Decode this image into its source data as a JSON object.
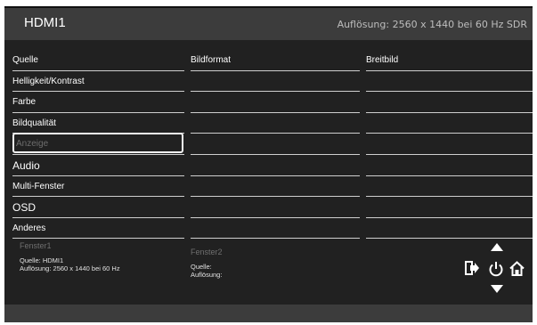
{
  "header": {
    "title": "HDMI1",
    "resolution": "Auflösung: 2560 x 1440 bei 60 Hz SDR"
  },
  "menu": {
    "items": [
      "Quelle",
      "Helligkeit/Kontrast",
      "Farbe",
      "Bildqualität",
      "Anzeige",
      "Audio",
      "Multi-Fenster",
      "OSD",
      "Anderes"
    ],
    "selected": "Anzeige"
  },
  "column2": {
    "header": "Bildformat"
  },
  "column3": {
    "header": "Breitbild"
  },
  "footer": {
    "window1": {
      "title": "Fenster1",
      "source": "Quelle: HDMI1",
      "resolution": "Auflösung: 2560 x 1440 bei 60 Hz"
    },
    "window2": {
      "title": "Fenster2",
      "source": "Quelle:",
      "resolution": "Auflösung:"
    }
  },
  "icons": [
    "arrow-up-icon",
    "input-source-icon",
    "power-icon",
    "home-icon",
    "arrow-down-icon"
  ]
}
